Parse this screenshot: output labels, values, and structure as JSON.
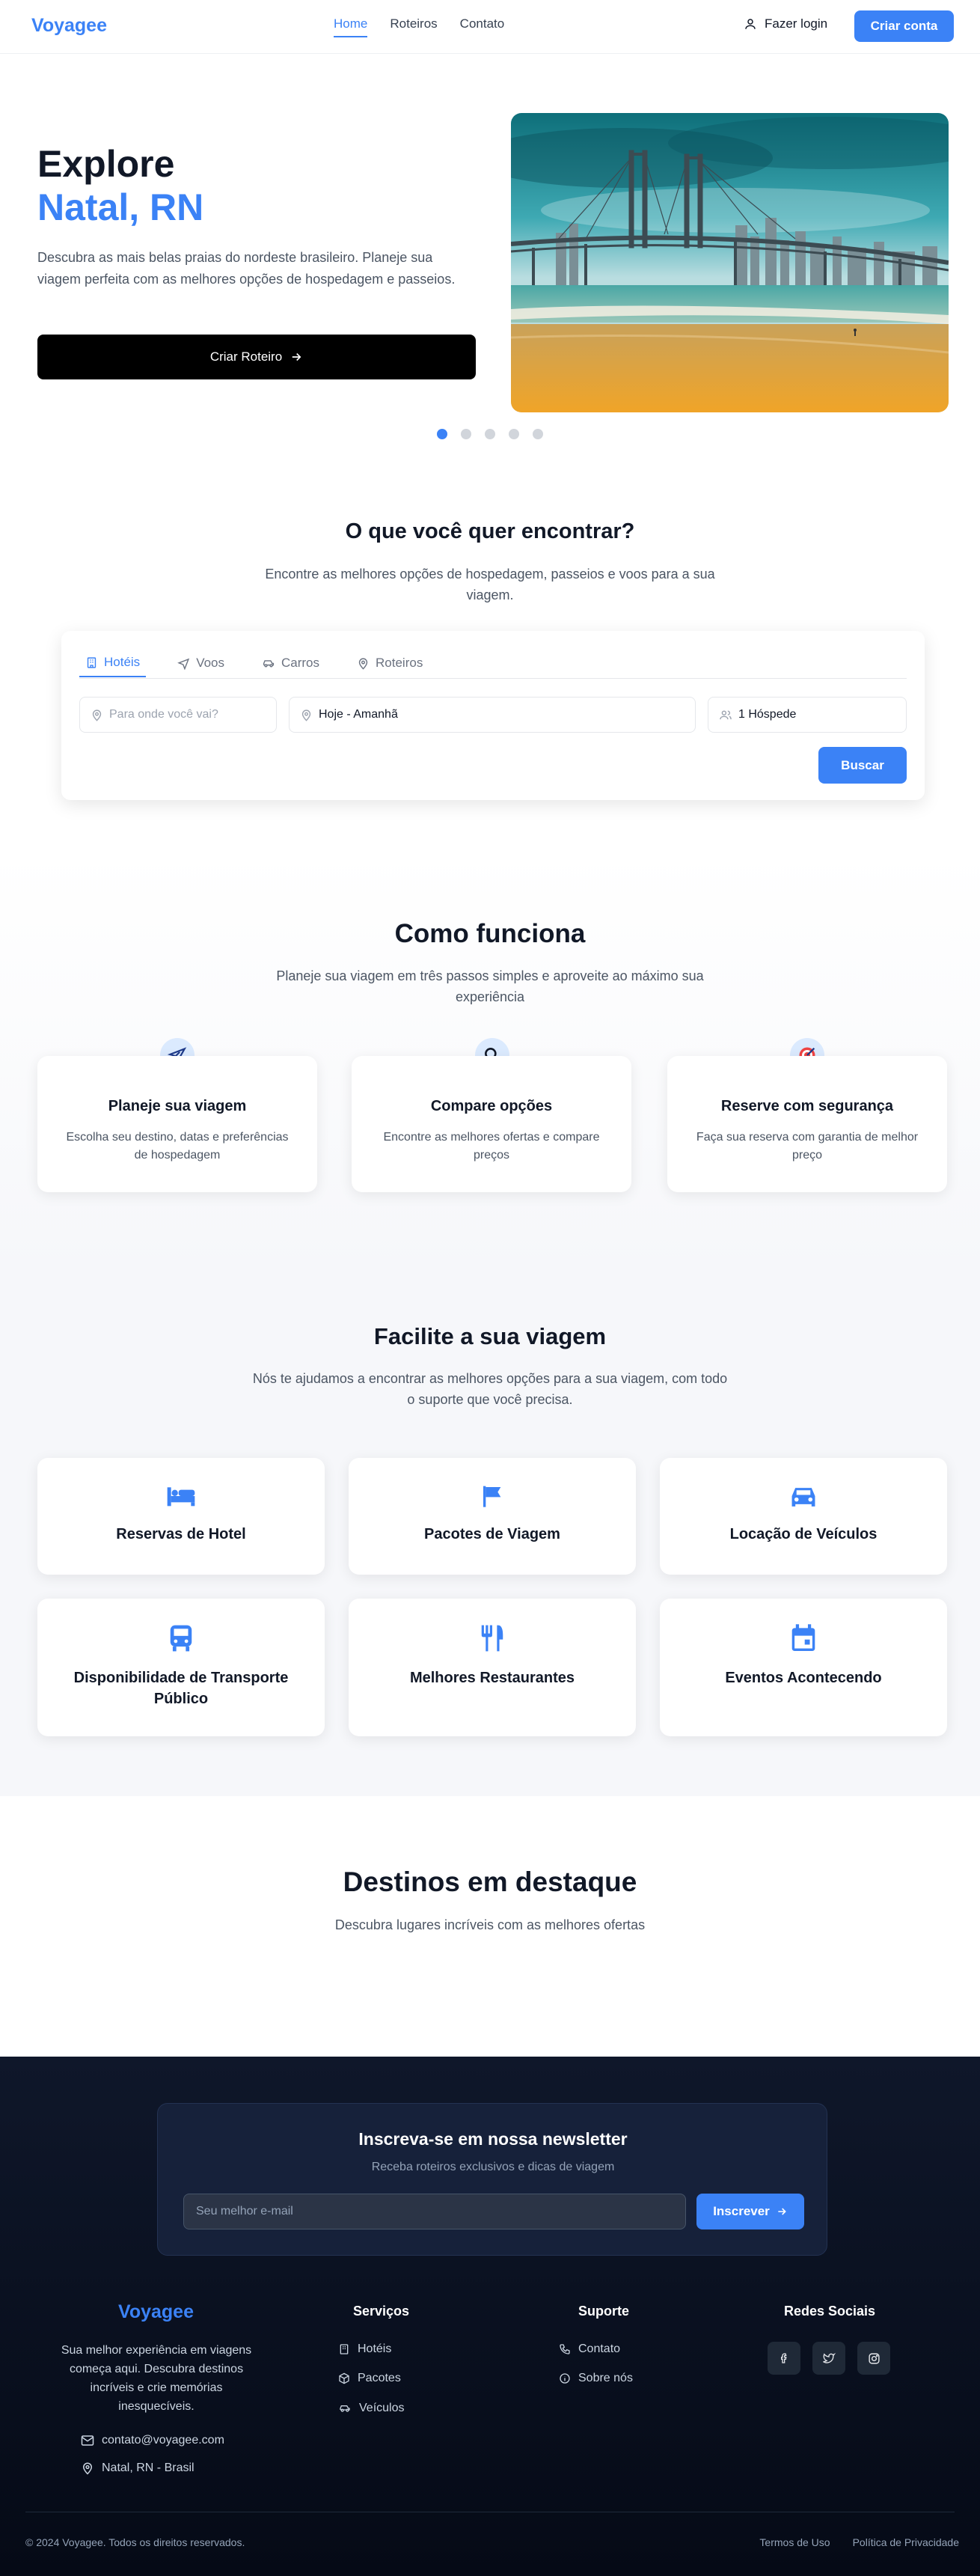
{
  "header": {
    "logo": "Voyagee",
    "nav": [
      "Home",
      "Roteiros",
      "Contato"
    ],
    "login": "Fazer login",
    "create_account": "Criar conta"
  },
  "hero": {
    "title_line1": "Explore",
    "title_line2": "Natal, RN",
    "description": "Descubra as mais belas praias do nordeste brasileiro. Planeje sua viagem perfeita com as melhores opções de hospedagem e passeios.",
    "cta": "Criar Roteiro",
    "carousel_active_index": 0,
    "carousel_count": 5
  },
  "search": {
    "title": "O que você quer encontrar?",
    "subtitle": "Encontre as melhores opções de hospedagem, passeios e voos para a sua viagem.",
    "tabs": [
      "Hotéis",
      "Voos",
      "Carros",
      "Roteiros"
    ],
    "destination_placeholder": "Para onde você vai?",
    "dates_value": "Hoje - Amanhã",
    "guests_value": "1 Hóspede",
    "button": "Buscar"
  },
  "how": {
    "title": "Como funciona",
    "subtitle": "Planeje sua viagem em três passos simples e aproveite ao máximo sua experiência",
    "steps": [
      {
        "title": "Planeje sua viagem",
        "text": "Escolha seu destino, datas e preferências de hospedagem",
        "icon": "airplane-icon"
      },
      {
        "title": "Compare opções",
        "text": "Encontre as melhores ofertas e compare preços",
        "icon": "magnifier-icon"
      },
      {
        "title": "Reserve com segurança",
        "text": "Faça sua reserva com garantia de melhor preço",
        "icon": "target-icon"
      }
    ]
  },
  "facilite": {
    "title": "Facilite a sua viagem",
    "subtitle": "Nós te ajudamos a encontrar as melhores opções para a sua viagem, com todo o suporte que você precisa.",
    "items": [
      {
        "label": "Reservas de Hotel",
        "icon": "bed-icon"
      },
      {
        "label": "Pacotes de Viagem",
        "icon": "flag-icon"
      },
      {
        "label": "Locação de Veículos",
        "icon": "car-icon"
      },
      {
        "label": "Disponibilidade de Transporte Público",
        "icon": "bus-icon"
      },
      {
        "label": "Melhores Restaurantes",
        "icon": "utensils-icon"
      },
      {
        "label": "Eventos Acontecendo",
        "icon": "calendar-icon"
      }
    ]
  },
  "destinations": {
    "title": "Destinos em destaque",
    "subtitle": "Descubra lugares incríveis com as melhores ofertas"
  },
  "newsletter": {
    "title": "Inscreva-se em nossa newsletter",
    "subtitle": "Receba roteiros exclusivos e dicas de viagem",
    "placeholder": "Seu melhor e-mail",
    "button": "Inscrever"
  },
  "footer": {
    "logo": "Voyagee",
    "description": "Sua melhor experiência em viagens começa aqui. Descubra destinos incríveis e crie memórias inesquecíveis.",
    "email": "contato@voyagee.com",
    "location": "Natal, RN - Brasil",
    "services_title": "Serviços",
    "services": [
      "Hotéis",
      "Pacotes",
      "Veículos"
    ],
    "support_title": "Suporte",
    "support": [
      "Contato",
      "Sobre nós"
    ],
    "social_title": "Redes Sociais",
    "social": [
      "facebook-icon",
      "twitter-icon",
      "instagram-icon"
    ],
    "copyright": "© 2024 Voyagee. Todos os direitos reservados.",
    "terms": "Termos de Uso",
    "privacy": "Política de Privacidade"
  },
  "colors": {
    "accent": "#3b82f6",
    "dark": "#0f172a"
  }
}
